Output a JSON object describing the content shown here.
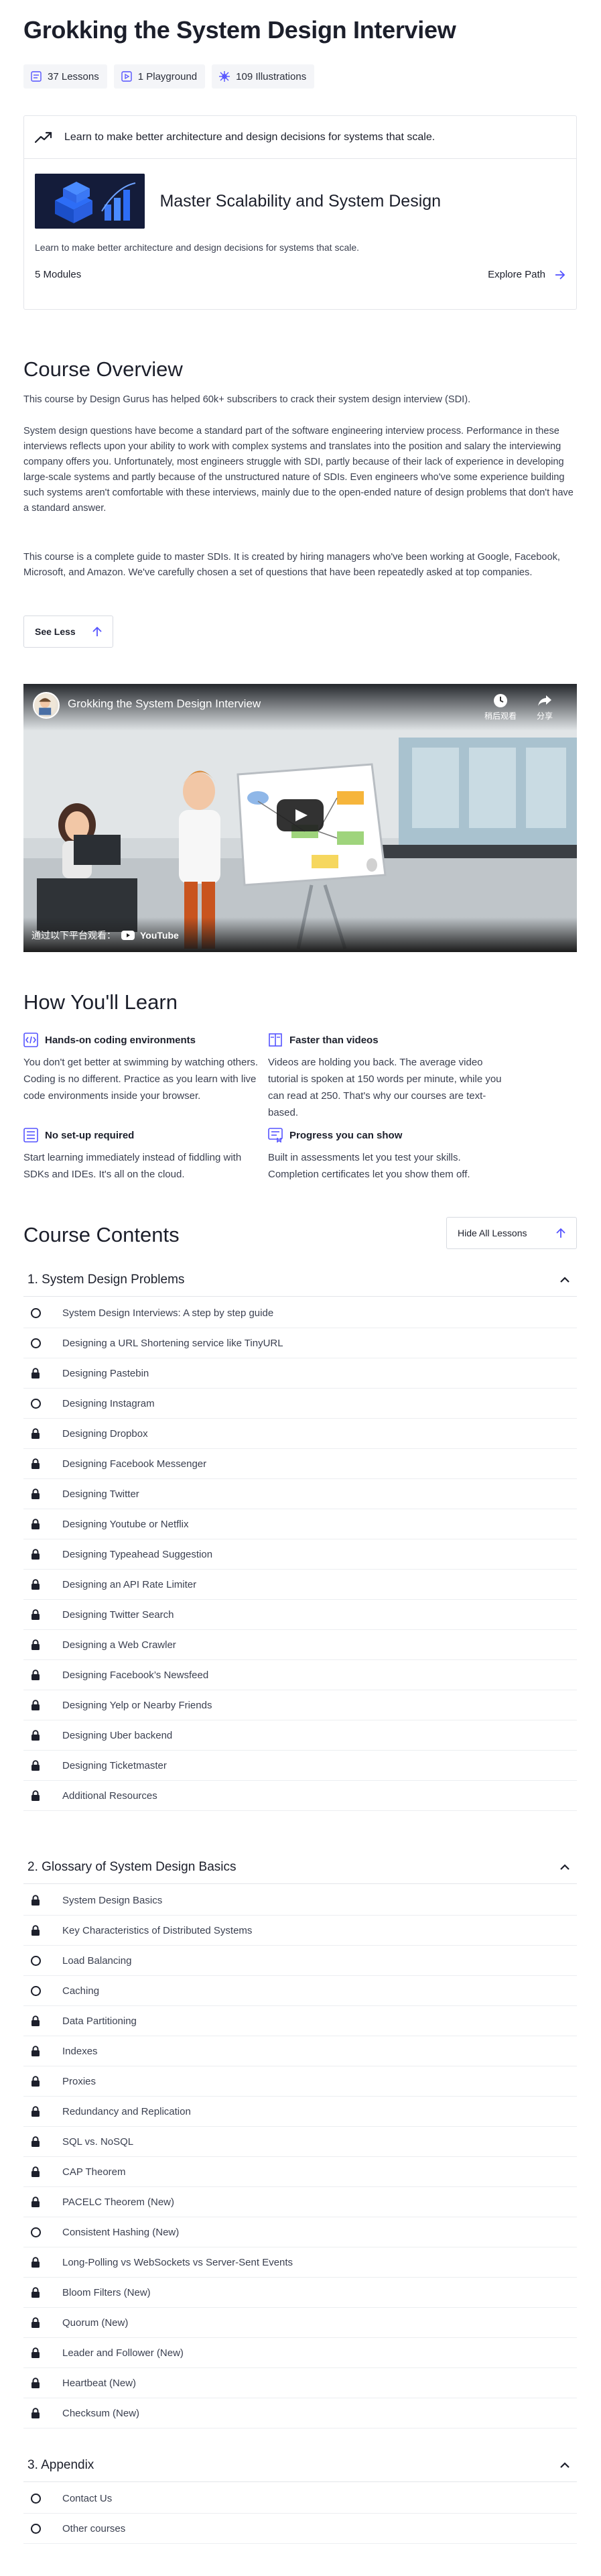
{
  "title": "Grokking the System Design Interview",
  "stats": [
    {
      "icon": "lessons-icon",
      "label": "37 Lessons"
    },
    {
      "icon": "playground-icon",
      "label": "1 Playground"
    },
    {
      "icon": "illustrations-icon",
      "label": "109 Illustrations"
    }
  ],
  "path_card": {
    "headline": "Learn to make better architecture and design decisions for systems that scale.",
    "name": "Master Scalability and System Design",
    "description": "Learn to make better architecture and design decisions for systems that scale.",
    "modules": "5 Modules",
    "explore_label": "Explore Path"
  },
  "overview": {
    "heading": "Course Overview",
    "paragraphs": [
      "This course by Design Gurus has helped 60k+ subscribers to crack their system design interview (SDI).",
      "System design questions have become a standard part of the software engineering interview process. Performance in these interviews reflects upon your ability to work with complex systems and translates into the position and salary the interviewing company offers you. Unfortunately, most engineers struggle with SDI, partly because of their lack of experience in developing large-scale systems and partly because of the unstructured nature of SDIs. Even engineers who've some experience building such systems aren't comfortable with these interviews, mainly due to the open-ended nature of design problems that don't have a standard answer.",
      "This course is a complete guide to master SDIs. It is created by hiring managers who've been working at Google, Facebook, Microsoft, and Amazon. We've carefully chosen a set of questions that have been repeatedly asked at top companies."
    ],
    "see_less": "See Less"
  },
  "video": {
    "title": "Grokking the System Design Interview",
    "watch_later": "稍后观看",
    "share": "分享",
    "watch_on": "通过以下平台观看：",
    "youtube": "YouTube"
  },
  "learn": {
    "heading": "How You'll Learn",
    "items": [
      {
        "icon": "code-icon",
        "title": "Hands-on coding environments",
        "text": "You don't get better at swimming by watching others. Coding is no different. Practice as you learn with live code environments inside your browser."
      },
      {
        "icon": "book-icon",
        "title": "Faster than videos",
        "text": "Videos are holding you back. The average video tutorial is spoken at 150 words per minute, while you can read at 250. That's why our courses are text-based."
      },
      {
        "icon": "setup-icon",
        "title": "No set-up required",
        "text": "Start learning immediately instead of fiddling with SDKs and IDEs. It's all on the cloud."
      },
      {
        "icon": "progress-icon",
        "title": "Progress you can show",
        "text": "Built in assessments let you test your skills. Completion certificates let you show them off."
      }
    ]
  },
  "contents": {
    "heading": "Course Contents",
    "hide_all": "Hide All Lessons",
    "modules": [
      {
        "title": "1. System Design Problems",
        "lessons": [
          {
            "title": "System Design Interviews: A step by step guide",
            "locked": false
          },
          {
            "title": "Designing a URL Shortening service like TinyURL",
            "locked": false
          },
          {
            "title": "Designing Pastebin",
            "locked": true
          },
          {
            "title": "Designing Instagram",
            "locked": false
          },
          {
            "title": "Designing Dropbox",
            "locked": true
          },
          {
            "title": "Designing Facebook Messenger",
            "locked": true
          },
          {
            "title": "Designing Twitter",
            "locked": true
          },
          {
            "title": "Designing Youtube or Netflix",
            "locked": true
          },
          {
            "title": "Designing Typeahead Suggestion",
            "locked": true
          },
          {
            "title": "Designing an API Rate Limiter",
            "locked": true
          },
          {
            "title": "Designing Twitter Search",
            "locked": true
          },
          {
            "title": "Designing a Web Crawler",
            "locked": true
          },
          {
            "title": "Designing Facebook’s Newsfeed",
            "locked": true
          },
          {
            "title": "Designing Yelp or Nearby Friends",
            "locked": true
          },
          {
            "title": "Designing Uber backend",
            "locked": true
          },
          {
            "title": "Designing Ticketmaster",
            "locked": true
          },
          {
            "title": "Additional Resources",
            "locked": true
          }
        ]
      },
      {
        "title": "2. Glossary of System Design Basics",
        "lessons": [
          {
            "title": "System Design Basics",
            "locked": true
          },
          {
            "title": "Key Characteristics of Distributed Systems",
            "locked": true
          },
          {
            "title": "Load Balancing",
            "locked": false
          },
          {
            "title": "Caching",
            "locked": false
          },
          {
            "title": "Data Partitioning",
            "locked": true
          },
          {
            "title": "Indexes",
            "locked": true
          },
          {
            "title": "Proxies",
            "locked": true
          },
          {
            "title": "Redundancy and Replication",
            "locked": true
          },
          {
            "title": "SQL vs. NoSQL",
            "locked": true
          },
          {
            "title": "CAP Theorem",
            "locked": true
          },
          {
            "title": "PACELC Theorem (New)",
            "locked": true
          },
          {
            "title": "Consistent Hashing (New)",
            "locked": false
          },
          {
            "title": "Long-Polling vs WebSockets vs Server-Sent Events",
            "locked": true
          },
          {
            "title": "Bloom Filters (New)",
            "locked": true
          },
          {
            "title": "Quorum (New)",
            "locked": true
          },
          {
            "title": "Leader and Follower (New)",
            "locked": true
          },
          {
            "title": "Heartbeat (New)",
            "locked": true
          },
          {
            "title": "Checksum (New)",
            "locked": true
          }
        ]
      },
      {
        "title": "3. Appendix",
        "lessons": [
          {
            "title": "Contact Us",
            "locked": false
          },
          {
            "title": "Other courses",
            "locked": false
          }
        ]
      }
    ]
  },
  "colors": {
    "accent": "#5553ff",
    "text": "#1c1f2b",
    "muted": "#3b4050",
    "border": "#e3e5ea"
  }
}
